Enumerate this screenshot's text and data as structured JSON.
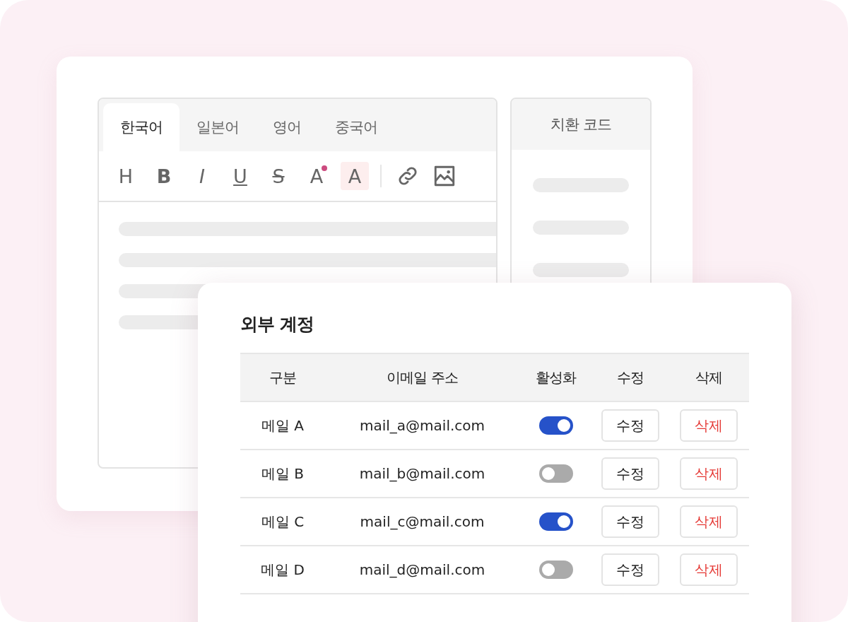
{
  "editor": {
    "tabs": [
      {
        "label": "한국어",
        "selected": true
      },
      {
        "label": "일본어",
        "selected": false
      },
      {
        "label": "영어",
        "selected": false
      },
      {
        "label": "중국어",
        "selected": false
      }
    ],
    "toolbar": [
      {
        "kind": "glyph",
        "label": "H",
        "selected": false
      },
      {
        "kind": "glyph",
        "label": "B",
        "selected": false
      },
      {
        "kind": "glyph",
        "label": "I",
        "selected": false
      },
      {
        "kind": "glyph",
        "label": "U",
        "selected": false
      },
      {
        "kind": "glyph",
        "label": "S",
        "selected": false
      },
      {
        "kind": "glyph",
        "label": "A",
        "selected": false
      },
      {
        "kind": "glyph",
        "label": "A",
        "selected": true
      },
      {
        "kind": "separator"
      },
      {
        "kind": "link"
      },
      {
        "kind": "image"
      }
    ]
  },
  "side_panel": {
    "title": "치환 코드"
  },
  "accounts": {
    "title": "외부 계정",
    "columns": [
      "구분",
      "이메일 주소",
      "활성화",
      "수정",
      "삭제"
    ],
    "rows": [
      {
        "name": "메일 A",
        "email": "mail_a@mail.com",
        "on": true,
        "edit": "수정",
        "delete": "삭제"
      },
      {
        "name": "메일 B",
        "email": "mail_b@mail.com",
        "on": false,
        "edit": "수정",
        "delete": "삭제"
      },
      {
        "name": "메일 C",
        "email": "mail_c@mail.com",
        "on": true,
        "edit": "수정",
        "delete": "삭제"
      },
      {
        "name": "메일 D",
        "email": "mail_d@mail.com",
        "on": false,
        "edit": "수정",
        "delete": "삭제"
      }
    ]
  }
}
